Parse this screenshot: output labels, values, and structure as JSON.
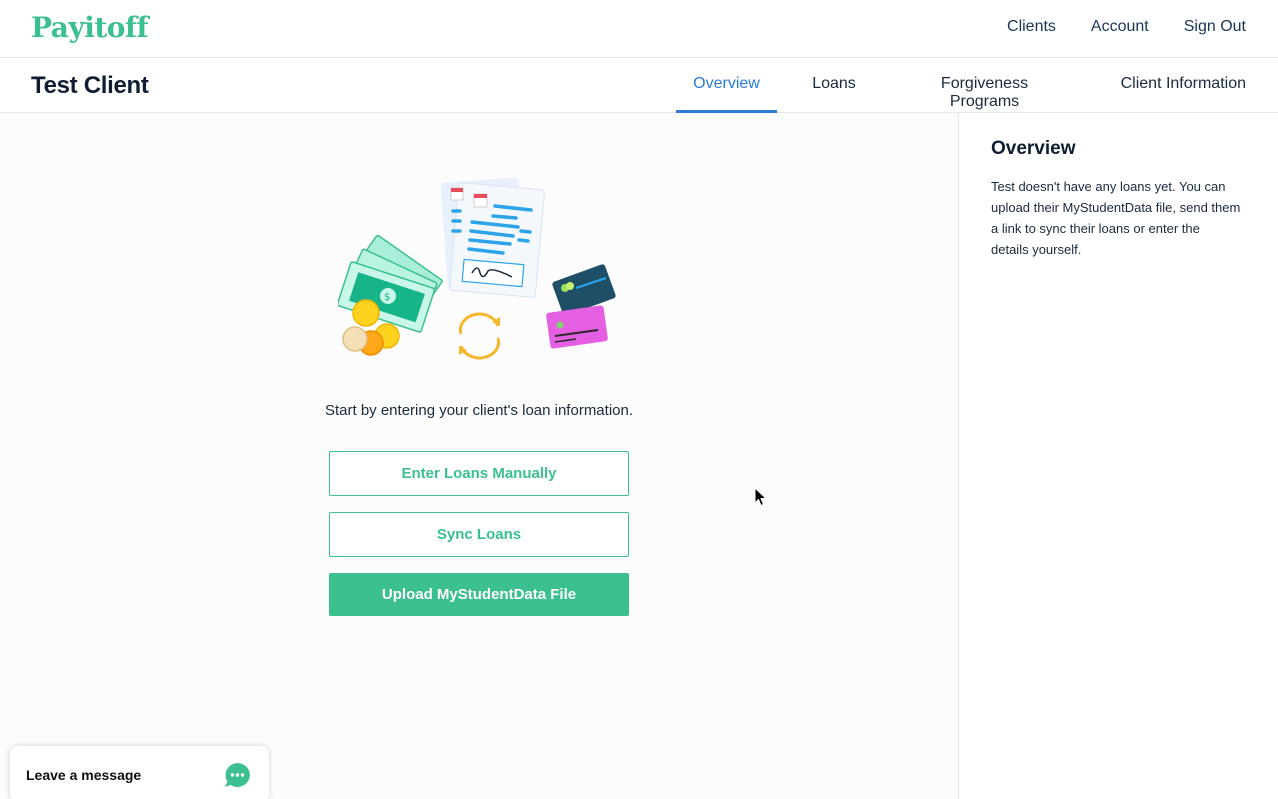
{
  "brand": {
    "name": "Payitoff",
    "color": "#3cc08f"
  },
  "topnav": {
    "items": [
      "Clients",
      "Account",
      "Sign Out"
    ]
  },
  "client": {
    "name": "Test Client"
  },
  "tabs": {
    "items": [
      "Overview",
      "Loans",
      "Forgiveness Programs",
      "Client Information"
    ],
    "active": "Overview",
    "active_color": "#2a7bd1"
  },
  "main": {
    "prompt": "Start by entering your client's loan information.",
    "buttons": {
      "enter_manually": "Enter Loans Manually",
      "sync": "Sync Loans",
      "upload": "Upload MyStudentData File"
    },
    "illustration_icons": [
      "document-icon",
      "money-icon",
      "coin-icon",
      "sync-icon",
      "credit-card-icon"
    ]
  },
  "sidebar": {
    "title": "Overview",
    "text": "Test doesn't have any loans yet. You can upload their MyStudentData file, send them a link to sync their loans or enter the details yourself."
  },
  "chat": {
    "label": "Leave a message"
  }
}
